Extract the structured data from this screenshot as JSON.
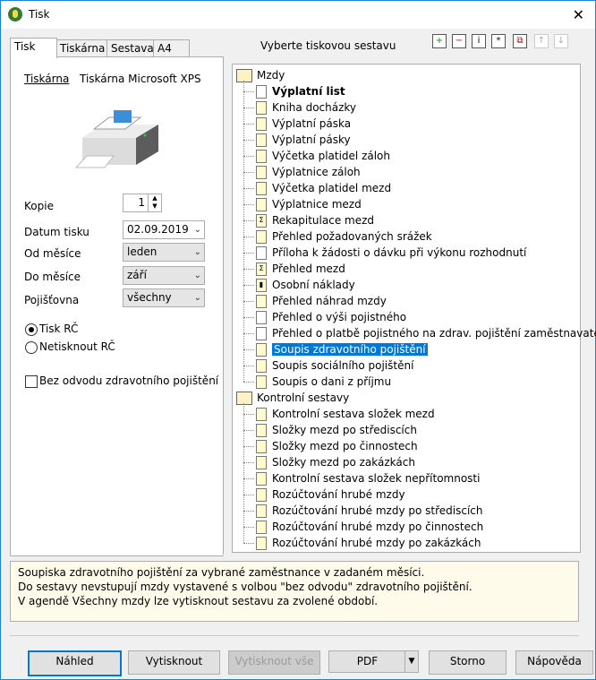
{
  "window": {
    "title": "Tisk"
  },
  "tabs": [
    {
      "label": "Tisk"
    },
    {
      "label": "Tiskárna"
    },
    {
      "label": "Sestava"
    },
    {
      "label": "A4"
    }
  ],
  "header": {
    "prompt": "Vyberte tiskovou sestavu"
  },
  "toolbar": {
    "icons": [
      "add-icon",
      "remove-icon",
      "info-icon",
      "star-icon",
      "copy-icon",
      "move-up-icon",
      "move-down-icon"
    ]
  },
  "print_tab": {
    "printer_label": "Tiskárna",
    "printer_value": "Tiskárna Microsoft XPS",
    "copies_label": "Kopie",
    "copies_value": "1",
    "date_label": "Datum tisku",
    "date_value": "02.09.2019",
    "from_month_label": "Od měsíce",
    "from_month_value": "leden",
    "to_month_label": "Do měsíce",
    "to_month_value": "září",
    "insurer_label": "Pojišťovna",
    "insurer_value": "všechny",
    "radio_print_rc": "Tisk RČ",
    "radio_no_print_rc": "Netisknout RČ",
    "checkbox_no_health": "Bez odvodu zdravotního pojištění"
  },
  "tree": {
    "groups": [
      {
        "label": "Mzdy",
        "items": [
          "Výplatní list",
          "Kniha docházky",
          "Výplatní páska",
          "Výplatní pásky",
          "Výčetka platidel záloh",
          "Výplatnice záloh",
          "Výčetka platidel mezd",
          "Výplatnice mezd",
          "Rekapitulace mezd",
          "Přehled požadovaných srážek",
          "Příloha k žádosti o dávku při výkonu rozhodnutí",
          "Přehled mezd",
          "Osobní náklady",
          "Přehled náhrad mzdy",
          "Přehled o výši pojistného",
          "Přehled o platbě pojistného na zdrav. pojištění zaměstnavatele",
          "Soupis zdravotního pojištění",
          "Soupis sociálního pojištění",
          "Soupis o dani z příjmu"
        ]
      },
      {
        "label": "Kontrolní sestavy",
        "items": [
          "Kontrolní sestava složek mezd",
          "Složky mezd po střediscích",
          "Složky mezd po činnostech",
          "Složky mezd po zakázkách",
          "Kontrolní sestava složek nepřítomnosti",
          "Rozúčtování hrubé mzdy",
          "Rozúčtování hrubé mzdy po střediscích",
          "Rozúčtování hrubé mzdy po činnostech",
          "Rozúčtování hrubé mzdy po zakázkách"
        ]
      }
    ]
  },
  "info": {
    "lines": [
      "Soupiska zdravotního pojištění za vybrané zaměstnance v zadaném měsíci.",
      "Do sestavy nevstupují mzdy vystavené s volbou \"bez odvodu\" zdravotního pojištění.",
      "V agendě Všechny mzdy lze vytisknout sestavu za zvolené období."
    ]
  },
  "buttons": {
    "preview": "Náhled",
    "print": "Vytisknout",
    "print_all": "Vytisknout vše",
    "pdf": "PDF",
    "cancel": "Storno",
    "help": "Nápověda"
  }
}
